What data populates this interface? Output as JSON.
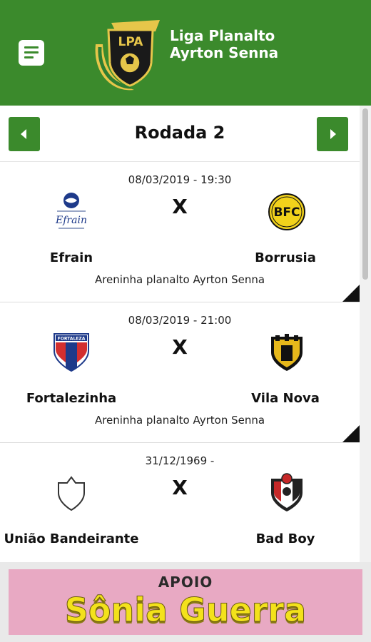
{
  "header": {
    "logo_badge_text": "LPA",
    "logo_line1": "Liga Planalto",
    "logo_line2": "Ayrton Senna",
    "menu_icon": "menu-icon",
    "brand_color": "#3b8a2c"
  },
  "round": {
    "title": "Rodada 2",
    "prev_icon": "chevron-left-icon",
    "next_icon": "chevron-right-icon"
  },
  "matches": [
    {
      "datetime": "08/03/2019 - 19:30",
      "home_team": "Efrain",
      "away_team": "Borrusia",
      "vs": "X",
      "venue": "Areninha planalto Ayrton Senna",
      "home_crest_text": "Efrain",
      "away_crest_text": "BFC"
    },
    {
      "datetime": "08/03/2019 - 21:00",
      "home_team": "Fortalezinha",
      "away_team": "Vila Nova",
      "vs": "X",
      "venue": "Areninha planalto Ayrton Senna",
      "home_crest_text": "FORTALEZA",
      "away_crest_text": ""
    },
    {
      "datetime": "31/12/1969 -",
      "home_team": "União Bandeirante",
      "away_team": "Bad Boy",
      "vs": "X",
      "venue": "",
      "home_crest_text": "",
      "away_crest_text": ""
    }
  ],
  "ad": {
    "label": "APOIO",
    "sponsor": "Sônia Guerra"
  }
}
